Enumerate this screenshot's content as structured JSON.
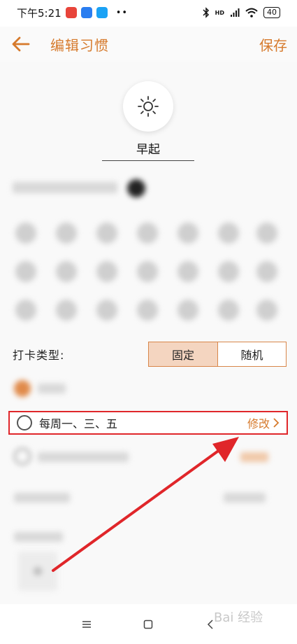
{
  "status_bar": {
    "time": "下午5:21",
    "network": "HD",
    "battery": "40"
  },
  "header": {
    "title": "编辑习惯",
    "save_label": "保存"
  },
  "habit": {
    "icon": "sun-icon",
    "name": "早起"
  },
  "checkin": {
    "type_label": "打卡类型:",
    "options": [
      "固定",
      "随机"
    ],
    "selected": "固定"
  },
  "schedule_option": {
    "text": "每周一、三、五",
    "action": "修改"
  },
  "nav": {
    "icons": [
      "menu-icon",
      "home-icon",
      "back-icon"
    ]
  },
  "watermark": "Bai 经验",
  "colors": {
    "accent": "#d67a2c",
    "highlight": "#e0262a",
    "segment_active": "#f4d5c0"
  }
}
